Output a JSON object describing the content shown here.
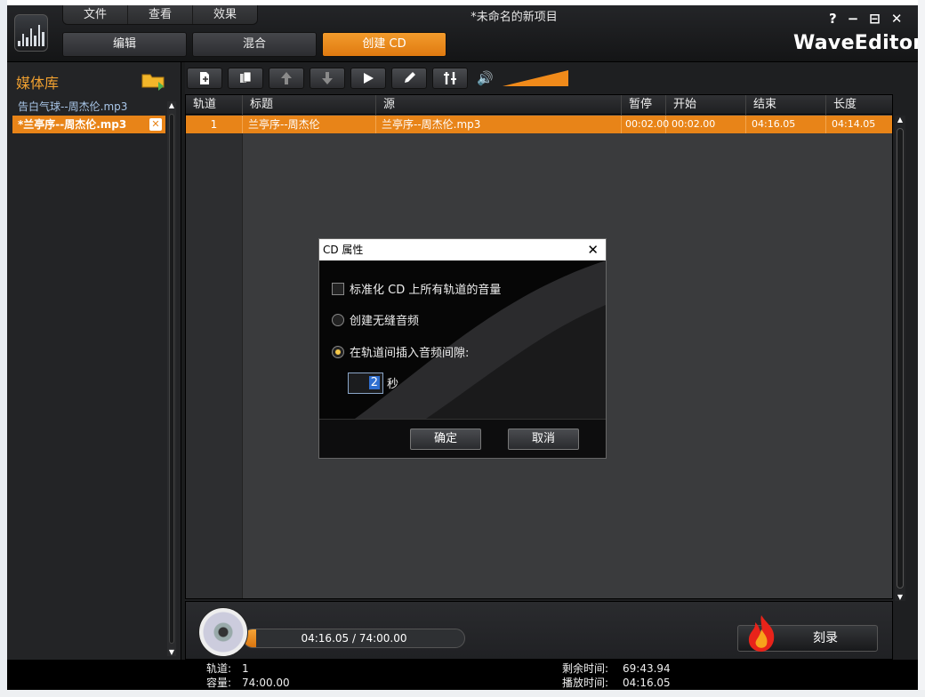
{
  "window": {
    "title": "*未命名的新项目",
    "brand": "WaveEditor",
    "help": "?",
    "minimize": "−",
    "maximize": "⊟",
    "close": "✕"
  },
  "menu": [
    "文件",
    "查看",
    "效果"
  ],
  "tabs": [
    {
      "label": "编辑",
      "active": false
    },
    {
      "label": "混合",
      "active": false
    },
    {
      "label": "创建 CD",
      "active": true
    }
  ],
  "library": {
    "title": "媒体库",
    "items": [
      {
        "label": "告白气球--周杰伦.mp3",
        "selected": false
      },
      {
        "label": "*兰亭序--周杰伦.mp3",
        "selected": true
      }
    ],
    "remove_glyph": "✕"
  },
  "toolbar": {
    "volume_level": 1.0
  },
  "table": {
    "headers": [
      "轨道",
      "标题",
      "源",
      "暂停",
      "开始",
      "结束",
      "长度"
    ],
    "rows": [
      [
        "1",
        "兰亭序--周杰伦",
        "兰亭序--周杰伦.mp3",
        "00:02.00",
        "00:02.00",
        "04:16.05",
        "04:14.05"
      ]
    ]
  },
  "progress": {
    "text": "04:16.05 / 74:00.00",
    "fraction": 0.058
  },
  "burn": {
    "label": "刻录"
  },
  "status": {
    "track_label": "轨道:",
    "track_value": "1",
    "capacity_label": "容量:",
    "capacity_value": "74:00.00",
    "remaining_label": "剩余时间:",
    "remaining_value": "69:43.94",
    "playtime_label": "播放时间:",
    "playtime_value": "04:16.05"
  },
  "dialog": {
    "title": "CD 属性",
    "close": "✕",
    "opt_normalize": "标准化 CD 上所有轨道的音量",
    "opt_gapless": "创建无缝音频",
    "opt_gap": "在轨道间插入音频间隙:",
    "gap_value": "2",
    "gap_unit": "秒",
    "ok": "确定",
    "cancel": "取消"
  },
  "colors": {
    "accent": "#e88418",
    "background": "#1e1f21"
  }
}
